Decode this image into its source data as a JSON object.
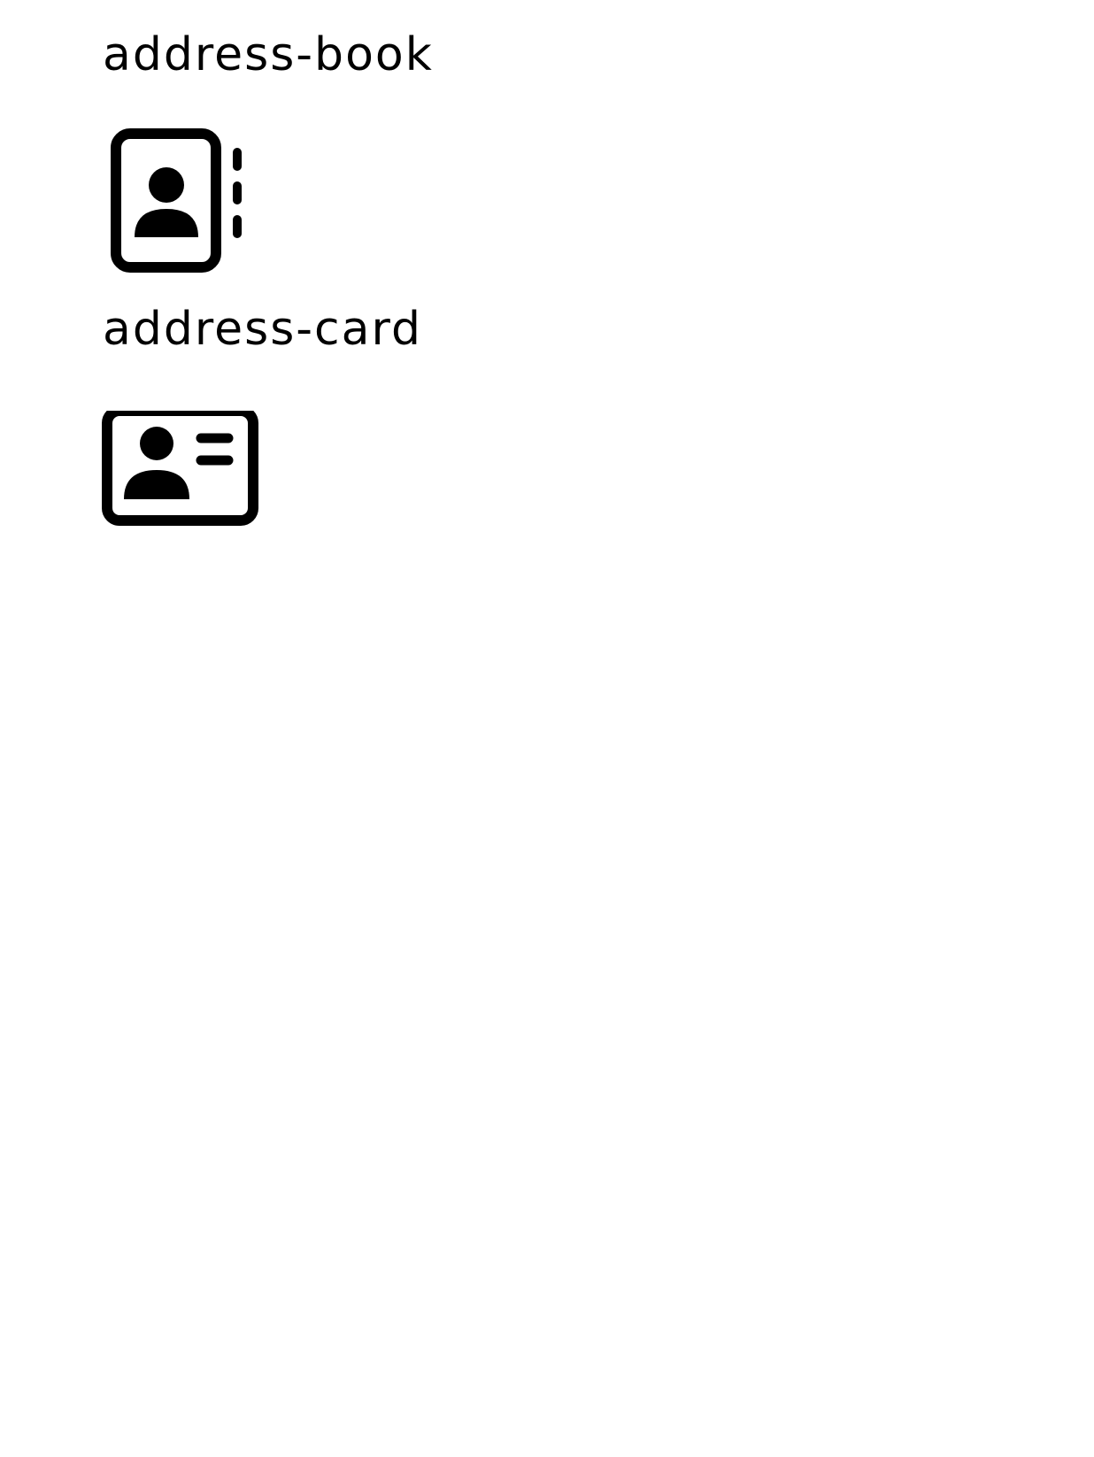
{
  "icons": [
    {
      "label": "address-book",
      "icon": "address-book-icon"
    },
    {
      "label": "address-card",
      "icon": "address-card-icon"
    }
  ],
  "colors": {
    "foreground": "#000000",
    "background": "#ffffff"
  }
}
